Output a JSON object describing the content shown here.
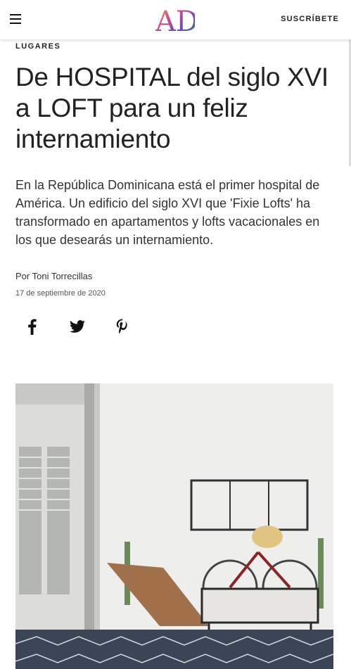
{
  "header": {
    "logo_text": "AD",
    "subscribe_label": "SUSCRÍBETE",
    "menu_icon": "hamburger-menu-icon"
  },
  "article": {
    "category": "LUGARES",
    "title": "De HOSPITAL del siglo XVI a LOFT para un feliz internamiento",
    "dek": "En la República Dominicana está el primer hospital de América. Un edificio del siglo XVI que 'Fixie Lofts' ha transformado en apartamentos y lofts vacacionales en los que desearás un internamiento.",
    "byline": "Por Toni Torrecillas",
    "date": "17 de septiembre de 2020"
  },
  "share": {
    "icons": [
      "facebook-icon",
      "twitter-icon",
      "pinterest-icon"
    ]
  },
  "colors": {
    "logo_gradient": [
      "#e9b63a",
      "#d24a8a",
      "#6a4bb8",
      "#2a8c6a"
    ],
    "text": "#222222"
  }
}
